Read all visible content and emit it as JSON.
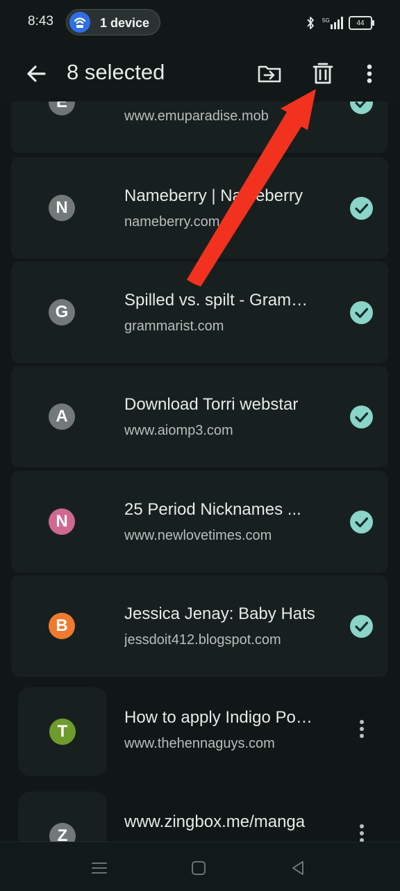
{
  "status_bar": {
    "time": "8:43",
    "device_pill": "1 device",
    "battery": "44",
    "network": "5G"
  },
  "app_bar": {
    "title": "8 selected"
  },
  "items": [
    {
      "letter": "E",
      "title": "",
      "url": "www.emuparadise.mob",
      "color": "#6f7574",
      "selected": true
    },
    {
      "letter": "N",
      "title": "Nameberry | Nameberry",
      "url": "nameberry.com",
      "color": "#737978",
      "selected": true
    },
    {
      "letter": "G",
      "title": "Spilled vs. spilt - Grammarist",
      "url": "grammarist.com",
      "color": "#737978",
      "selected": true
    },
    {
      "letter": "A",
      "title": "Download Torri webstar",
      "url": "www.aiomp3.com",
      "color": "#737978",
      "selected": true
    },
    {
      "letter": "N",
      "title": "25 Period Nicknames ...",
      "url": "www.newlovetimes.com",
      "color": "#d0698f",
      "selected": true
    },
    {
      "letter": "B",
      "title": "Jessica Jenay: Baby Hats",
      "url": "jessdoit412.blogspot.com",
      "color": "#f07a2d",
      "selected": true
    },
    {
      "letter": "T",
      "title": "How to apply Indigo Powder",
      "url": "www.thehennaguys.com",
      "color": "#6d9b2c",
      "selected": false
    },
    {
      "letter": "Z",
      "title": "www.zingbox.me/manga",
      "url": "",
      "color": "#737978",
      "selected": false
    }
  ],
  "icons": {
    "back": "arrow-left-icon",
    "move": "folder-move-icon",
    "delete": "trash-icon",
    "more": "more-vert-icon",
    "check": "check-circle-icon",
    "nav_menu": "menu-icon",
    "nav_home": "home-icon",
    "nav_back": "back-triangle-icon"
  },
  "colors": {
    "accent_check": "#8ad4c8",
    "arrow": "#f2321f",
    "background": "#101716"
  }
}
